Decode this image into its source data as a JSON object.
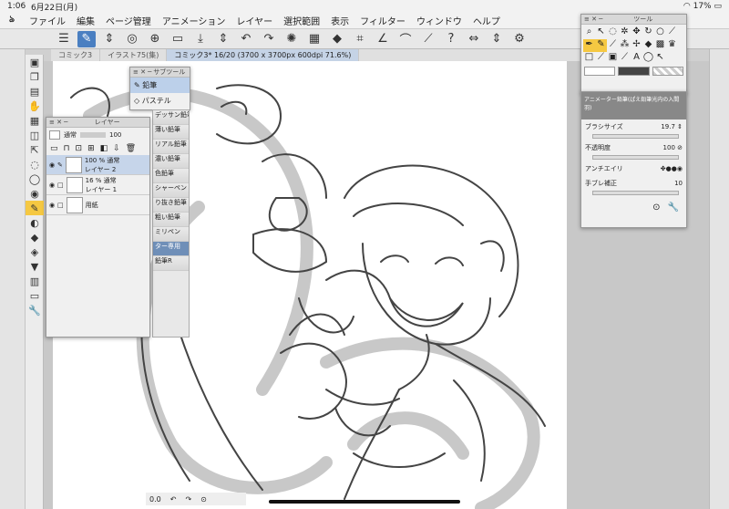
{
  "status": {
    "time": "1:06",
    "date": "6月22日(月)",
    "battery": "17%"
  },
  "menu": [
    "ファイル",
    "編集",
    "ページ管理",
    "アニメーション",
    "レイヤー",
    "選択範囲",
    "表示",
    "フィルター",
    "ウィンドウ",
    "ヘルプ"
  ],
  "tabs": [
    "コミック3",
    "イラスト75(集)",
    "コミック3* 16/20 (3700 x 3700px 600dpi 71.6%)"
  ],
  "subtool": {
    "title": "サブツール",
    "items": [
      "鉛筆",
      "パステル"
    ]
  },
  "brushes": [
    "デッサン鉛筆",
    "薄い鉛筆",
    "リアル鉛筆",
    "濃い鉛筆",
    "色鉛筆",
    "シャーペン",
    "り抜き鉛筆",
    "粗い鉛筆",
    "ミリペン",
    "ター専用",
    "鉛筆R"
  ],
  "layers": {
    "title": "レイヤー",
    "blend": "通常",
    "opacity": "100",
    "rows": [
      {
        "line1": "100 % 通常",
        "line2": "レイヤー 2"
      },
      {
        "line1": "16 % 通常",
        "line2": "レイヤー 1"
      },
      {
        "line1": "",
        "line2": "用紙"
      }
    ]
  },
  "toolpanel": {
    "title": "ツール"
  },
  "toolprop": {
    "brush_name": "アニメーター鉛筆(ぱえ鉛筆光内の入間羽)",
    "size_label": "ブラシサイズ",
    "size_value": "19.7",
    "opacity_label": "不透明度",
    "opacity_value": "100",
    "aa_label": "アンチエイリ",
    "stab_label": "手ブレ補正",
    "stab_value": "10"
  },
  "canvas": {
    "zoom": "0.0"
  }
}
